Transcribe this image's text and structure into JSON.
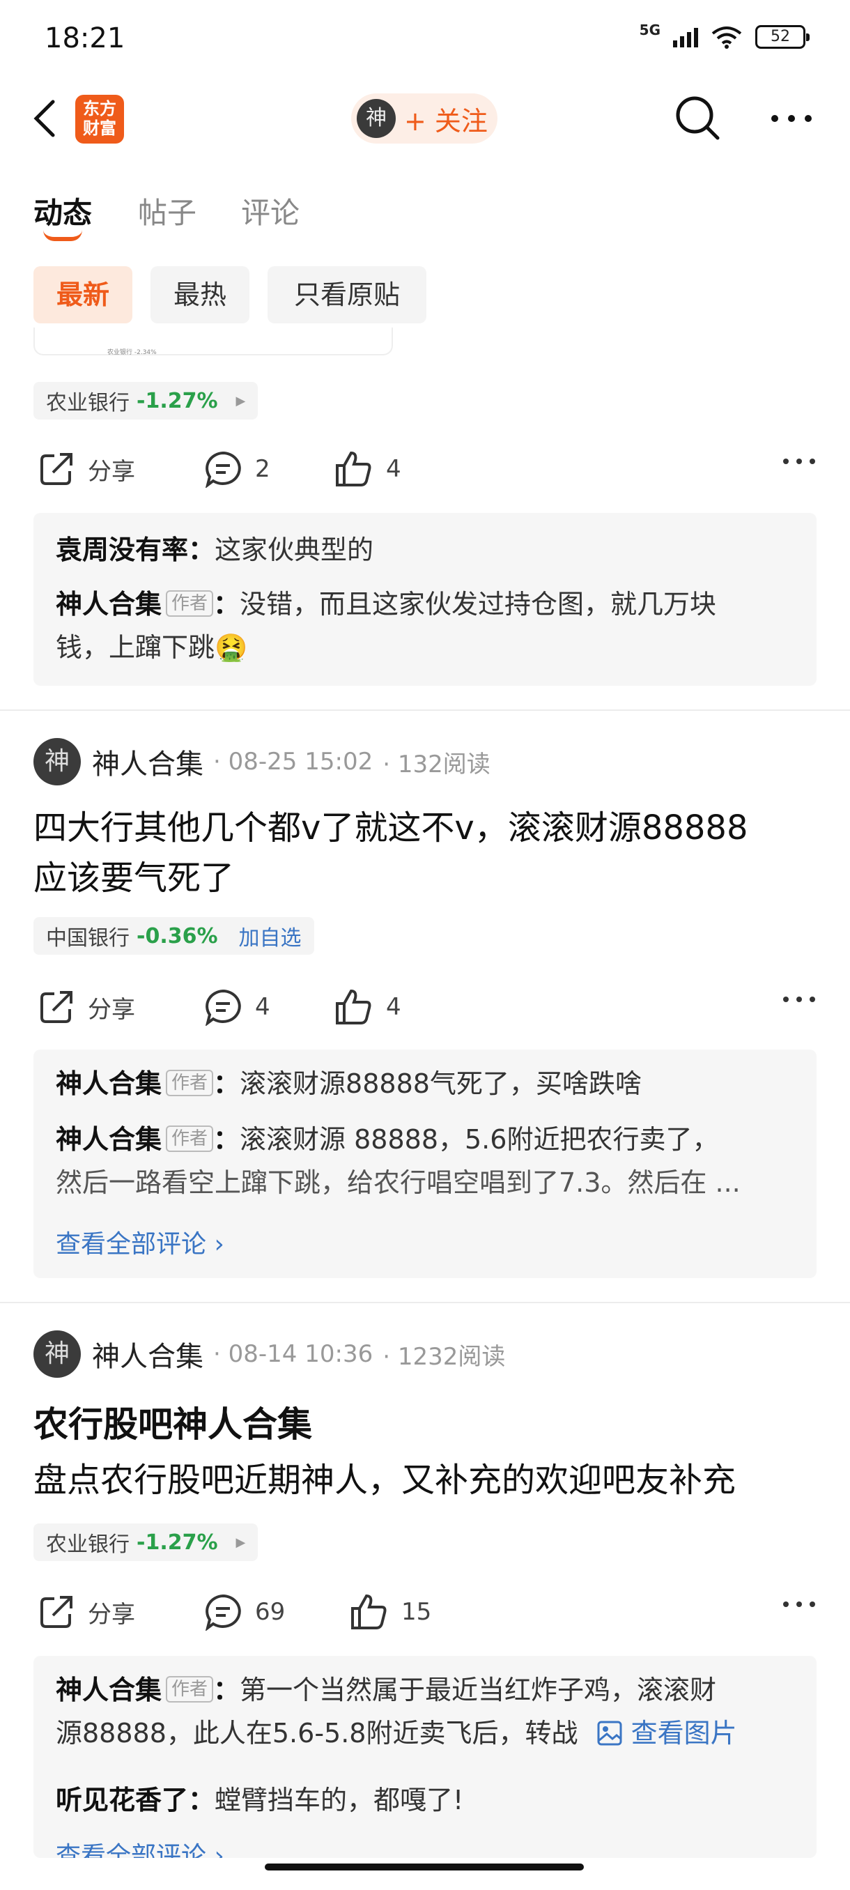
{
  "status": {
    "time": "18:21",
    "network": "5G",
    "battery": "52"
  },
  "nav": {
    "logo_line1": "东方",
    "logo_line2": "财富",
    "avatar_glyph": "神",
    "follow_label": "+ 关注"
  },
  "tabs": [
    "动态",
    "帖子",
    "评论"
  ],
  "filters": [
    "最新",
    "最热",
    "只看原贴"
  ],
  "post0": {
    "stock": {
      "name": "农业银行",
      "change": "-1.27%"
    },
    "actions": {
      "share": "分享",
      "comments": "2",
      "likes": "4"
    },
    "image_caption": "农业银行 -2.34%",
    "comments": [
      {
        "user": "袁周没有率：",
        "text": "这家伙典型的"
      },
      {
        "user": "神人合集",
        "badge": "作者",
        "sep": "：",
        "text_line1": "没错，而且这家伙发过持仓图，就几万块",
        "text_line2": "钱，上蹿下跳🤮"
      }
    ]
  },
  "post1": {
    "author": "神人合集",
    "avatar_glyph": "神",
    "date": "· 08-25 15:02",
    "reads": "· 132阅读",
    "text_line1": "四大行其他几个都v了就这不v，滚滚财源88888",
    "text_line2": "应该要气死了",
    "stock": {
      "name": "中国银行",
      "change": "-0.36%",
      "add": "加自选"
    },
    "actions": {
      "share": "分享",
      "comments": "4",
      "likes": "4"
    },
    "comments": [
      {
        "user": "神人合集",
        "badge": "作者",
        "sep": "：",
        "text": "滚滚财源88888气死了，买啥跌啥"
      },
      {
        "user": "神人合集",
        "badge": "作者",
        "sep": "：",
        "text_line1": "滚滚财源 88888，5.6附近把农行卖了，",
        "text_line2": "然后一路看空上蹿下跳，给农行唱空唱到了7.3。然后在 ..."
      }
    ],
    "view_all": "查看全部评论 ›"
  },
  "post2": {
    "author": "神人合集",
    "avatar_glyph": "神",
    "date": "· 08-14 10:36",
    "reads": "· 1232阅读",
    "title": "农行股吧神人合集",
    "text": "盘点农行股吧近期神人，又补充的欢迎吧友补充",
    "stock": {
      "name": "农业银行",
      "change": "-1.27%"
    },
    "actions": {
      "share": "分享",
      "comments": "69",
      "likes": "15"
    },
    "comments": [
      {
        "user": "神人合集",
        "badge": "作者",
        "sep": "：",
        "text_line1": "第一个当然属于最近当红炸子鸡，滚滚财",
        "text_line2": "源88888，此人在5.6-5.8附近卖飞后，转战",
        "image_link": "查看图片"
      },
      {
        "user": "听见花香了：",
        "text": "螳臂挡车的，都嘎了!"
      }
    ],
    "view_all": "查看全部评论 ›"
  },
  "colors": {
    "accent": "#ef5b1a",
    "down_green": "#2aa04a",
    "link_blue": "#3a75c4"
  }
}
